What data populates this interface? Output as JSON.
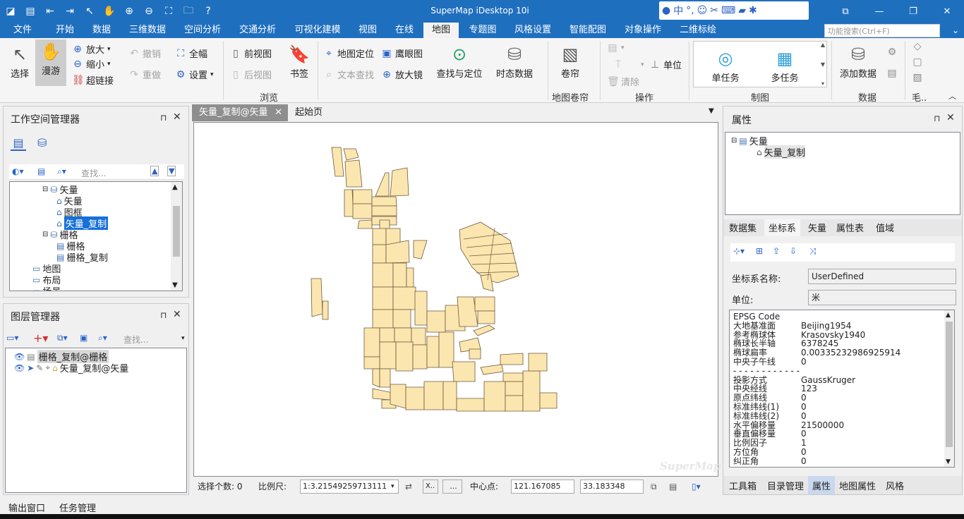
{
  "title_bar": {
    "title": "SuperMap iDesktop 10i",
    "ime": {
      "lang_label": "中",
      "punct_label": "°,"
    },
    "window_buttons": [
      "⧉",
      "—",
      "❐",
      "✕"
    ]
  },
  "menu": {
    "tabs": [
      "文件",
      "开始",
      "数据",
      "三维数据",
      "空间分析",
      "交通分析",
      "可视化建模",
      "视图",
      "在线",
      "地图",
      "专题图",
      "风格设置",
      "智能配图",
      "对象操作",
      "二维标绘"
    ],
    "active_index": 9,
    "search_placeholder": "功能搜索(Ctrl+F)"
  },
  "ribbon": {
    "select": "选择",
    "pan": "漫游",
    "zoom_in": "放大",
    "zoom_out": "缩小",
    "hyperlink": "超链接",
    "undo": "撤销",
    "redo": "重做",
    "full_extent": "全幅",
    "settings": "设置",
    "prev_view": "前视图",
    "next_view": "后视图",
    "bookmark": "书签",
    "map_locate": "地图定位",
    "text_find": "文本查找",
    "eagle_eye": "鹰眼图",
    "magnifier": "放大镜",
    "find_locate": "查找与定位",
    "temporal_data": "时态数据",
    "swipe": "卷帘",
    "clear": "清除",
    "unit": "单位",
    "single_task": "单任务",
    "multi_task": "多任务",
    "add_data": "添加数据",
    "groups": {
      "browse": "浏览",
      "map_swipe": "地图卷帘",
      "operate": "操作",
      "cartography": "制图",
      "data": "数据",
      "more": "毛.."
    }
  },
  "workspace_manager": {
    "title": "工作空间管理器",
    "search_placeholder": "查找...",
    "tree": [
      {
        "label": "矢量",
        "level": 1,
        "icon": "datasource-icon"
      },
      {
        "label": "矢量",
        "level": 2,
        "icon": "region-dataset-icon"
      },
      {
        "label": "图框",
        "level": 2,
        "icon": "region-dataset-icon"
      },
      {
        "label": "矢量_复制",
        "level": 2,
        "icon": "region-dataset-icon",
        "selected": true
      },
      {
        "label": "栅格",
        "level": 1,
        "icon": "datasource-icon"
      },
      {
        "label": "栅格",
        "level": 2,
        "icon": "grid-dataset-icon"
      },
      {
        "label": "栅格_复制",
        "level": 2,
        "icon": "grid-dataset-icon"
      },
      {
        "label": "地图",
        "level": 0,
        "icon": "map-folder-icon"
      },
      {
        "label": "布局",
        "level": 0,
        "icon": "layout-folder-icon"
      },
      {
        "label": "场景",
        "level": 0,
        "icon": "scene-folder-icon"
      }
    ]
  },
  "layer_manager": {
    "title": "图层管理器",
    "search_placeholder": "查找...",
    "layers": [
      {
        "label": "栅格_复制@栅格",
        "selected": true
      },
      {
        "label": "矢量_复制@矢量",
        "selected": false
      }
    ]
  },
  "map_tabs": [
    "矢量_复制@矢量",
    "起始页"
  ],
  "map": {
    "watermark": "SuperMap",
    "fill_color": "#fbe6b0",
    "stroke_color": "#6e5a3a"
  },
  "status": {
    "selected_count_label": "选择个数: 0",
    "scale_label": "比例尺:",
    "scale_value": "1:3.21549259713111",
    "x_btn": "X..",
    "more_btn": "...",
    "center_label": "中心点:",
    "center_x": "121.167085",
    "center_y": "33.183348"
  },
  "properties": {
    "title": "属性",
    "tree_root": "矢量",
    "tree_child": "矢量_复制",
    "tabs": [
      "数据集",
      "坐标系",
      "矢量",
      "属性表",
      "值域"
    ],
    "active_tab": 1,
    "coord_name_label": "坐标系名称:",
    "coord_name_value": "UserDefined",
    "unit_label": "单位:",
    "unit_value": "米",
    "params": [
      {
        "k": "EPSG Code",
        "v": ""
      },
      {
        "k": "大地基准面",
        "v": "Beijing1954"
      },
      {
        "k": "参考椭球体",
        "v": "Krasovsky1940"
      },
      {
        "k": "椭球长半轴",
        "v": "6378245"
      },
      {
        "k": "椭球扁率",
        "v": "0.00335232986925914"
      },
      {
        "k": "中央子午线",
        "v": "0"
      },
      {
        "k": "- - - - - - - - - - - - - - -",
        "v": ""
      },
      {
        "k": "投影方式",
        "v": "GaussKruger"
      },
      {
        "k": "中央经线",
        "v": "123"
      },
      {
        "k": "原点纬线",
        "v": "0"
      },
      {
        "k": "标准纬线(1)",
        "v": "0"
      },
      {
        "k": "标准纬线(2)",
        "v": "0"
      },
      {
        "k": "水平偏移量",
        "v": "21500000"
      },
      {
        "k": "垂直偏移量",
        "v": "0"
      },
      {
        "k": "比例因子",
        "v": "1"
      },
      {
        "k": "方位角",
        "v": "0"
      },
      {
        "k": "纠正角",
        "v": "0"
      }
    ],
    "bottom_tabs": [
      "工具箱",
      "目录管理",
      "属性",
      "地图属性",
      "风格"
    ],
    "bottom_active": 2
  },
  "bottom_tabs": [
    "输出窗口",
    "任务管理"
  ]
}
